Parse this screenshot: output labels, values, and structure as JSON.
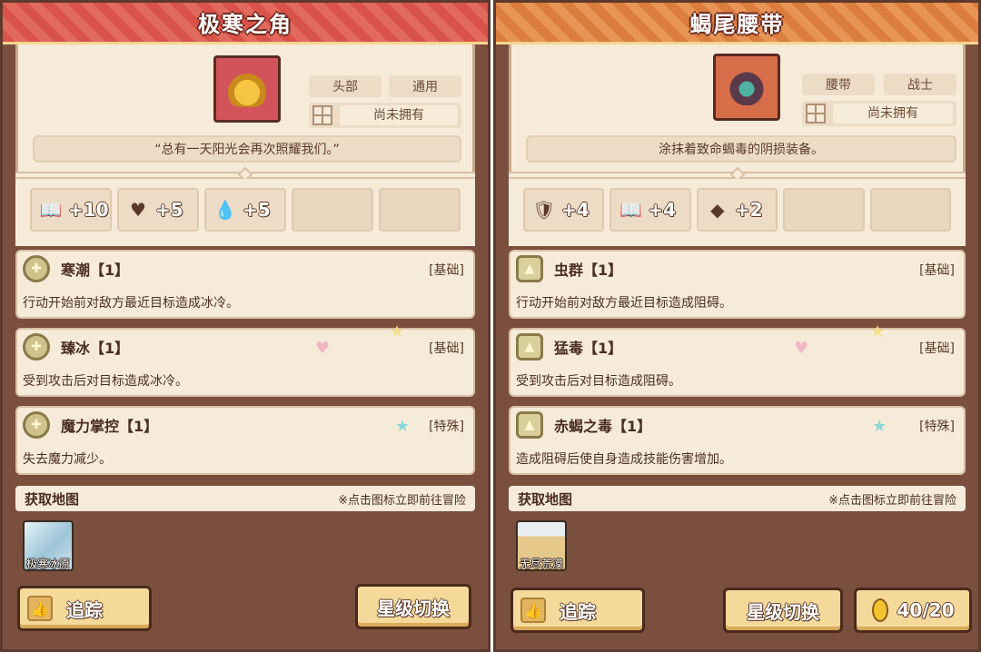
{
  "left": {
    "title": "极寒之角",
    "tags": [
      "头部",
      "通用"
    ],
    "ownership": "尚未拥有",
    "quote": "“总有一天阳光会再次照耀我们。”",
    "stats": [
      {
        "icon": "book-icon",
        "value": "+10"
      },
      {
        "icon": "heart-icon",
        "value": "+5"
      },
      {
        "icon": "water-drop-icon",
        "value": "+5"
      }
    ],
    "skills": [
      {
        "name": "寒潮【1】",
        "type": "[基础]",
        "desc": "行动开始前对敌方最近目标造成冰冷。"
      },
      {
        "name": "臻冰【1】",
        "type": "[基础]",
        "desc": "受到攻击后对目标造成冰冷。"
      },
      {
        "name": "魔力掌控【1】",
        "type": "[特殊]",
        "desc": "失去魔力减少。"
      }
    ],
    "map_title": "获取地图",
    "map_hint": "※点击图标立即前往冒险",
    "map_name": "极寒冰原",
    "track_label": "追踪",
    "star_switch_label": "星级切换"
  },
  "right": {
    "title": "蝎尾腰带",
    "tags": [
      "腰带",
      "战士"
    ],
    "ownership": "尚未拥有",
    "quote": "涂抹着致命蝎毒的阴损装备。",
    "stats": [
      {
        "icon": "shield-icon",
        "value": "+4"
      },
      {
        "icon": "book-icon",
        "value": "+4"
      },
      {
        "icon": "stone-icon",
        "value": "+2"
      }
    ],
    "skills": [
      {
        "name": "虫群【1】",
        "type": "[基础]",
        "desc": "行动开始前对敌方最近目标造成阻碍。"
      },
      {
        "name": "猛毒【1】",
        "type": "[基础]",
        "desc": "受到攻击后对目标造成阻碍。"
      },
      {
        "name": "赤蝎之毒【1】",
        "type": "[特殊]",
        "desc": "造成阻碍后使自身造成技能伤害增加。"
      }
    ],
    "map_title": "获取地图",
    "map_hint": "※点击图标立即前往冒险",
    "map_name": "无尽荒漠",
    "track_label": "追踪",
    "star_switch_label": "星级切换",
    "coin_count": "40/20"
  }
}
